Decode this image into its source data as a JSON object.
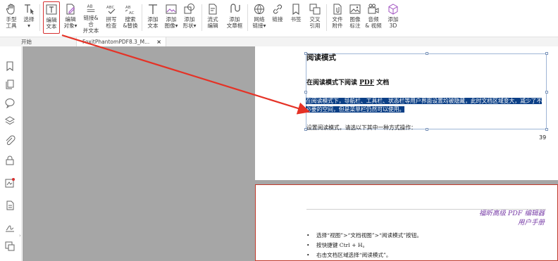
{
  "ribbon": {
    "tools": [
      {
        "label": "手型\n工具",
        "icon": "hand-icon"
      },
      {
        "label": "选择\n▾",
        "icon": "select-text-icon"
      },
      {
        "label": "编辑\n文本",
        "icon": "edit-text-icon",
        "active": true
      },
      {
        "label": "编辑\n对象▾",
        "icon": "edit-object-icon"
      },
      {
        "label": "链接&合\n并文本",
        "icon": "link-merge-text-icon"
      },
      {
        "label": "拼写\n检查",
        "icon": "spell-check-icon"
      },
      {
        "label": "搜索\n&替换",
        "icon": "search-replace-icon"
      },
      {
        "label": "添加\n文本",
        "icon": "add-text-icon"
      },
      {
        "label": "添加\n图像▾",
        "icon": "add-image-icon"
      },
      {
        "label": "添加\n形状▾",
        "icon": "add-shape-icon"
      },
      {
        "label": "流式\n编辑",
        "icon": "flow-edit-icon"
      },
      {
        "label": "添加\n文章框",
        "icon": "article-box-icon"
      },
      {
        "label": "网络\n链接▾",
        "icon": "web-link-icon"
      },
      {
        "label": "链接",
        "icon": "link-icon"
      },
      {
        "label": "书签",
        "icon": "bookmark-icon"
      },
      {
        "label": "交叉\n引用",
        "icon": "cross-reference-icon"
      },
      {
        "label": "文件\n附件",
        "icon": "file-attachment-icon"
      },
      {
        "label": "图像\n标注",
        "icon": "image-annotation-icon"
      },
      {
        "label": "音频\n& 视频",
        "icon": "audio-video-icon"
      },
      {
        "label": "添加\n3D",
        "icon": "add-3d-icon"
      }
    ]
  },
  "tabs": {
    "start": "开始",
    "document": "FoxitPhantomPDF8.3_M...",
    "close": "×"
  },
  "sidebar": {
    "icons": [
      "bookmark-icon",
      "pages-icon",
      "comments-icon",
      "layers-icon",
      "attachment-icon",
      "security-icon",
      "signature-icon",
      "content-icon",
      "fill-sign-icon",
      "destinations-icon"
    ]
  },
  "page1": {
    "title": "阅读模式",
    "subtitle_prefix": "在阅读模式下阅读 ",
    "subtitle_pdf": "PDF",
    "subtitle_suffix": " 文档",
    "paragraph": "在阅读模式下，导航栏、工具栏、状态栏等用户界面设置均被隐藏，此时文档区域变大，减少了不必要的空间，但是菜单栏仍然可以使用。",
    "setting": "设置阅读模式，请选以下其中一种方式操作：",
    "page_number": "39"
  },
  "page2": {
    "brand_line1": "福昕高级 PDF 编辑器",
    "brand_line2": "用户手册",
    "items": [
      "选择“视图”>“文档视图”>“阅读模式”按钮。",
      "按快捷键 Ctrl + H。",
      "右击文档区域选择“阅读模式”。"
    ]
  },
  "colors": {
    "accent_red": "#d62f2f",
    "selection_blue": "#0b3f86",
    "brand_purple": "#7a3fa8",
    "canvas_gray": "#a6a6a6"
  }
}
